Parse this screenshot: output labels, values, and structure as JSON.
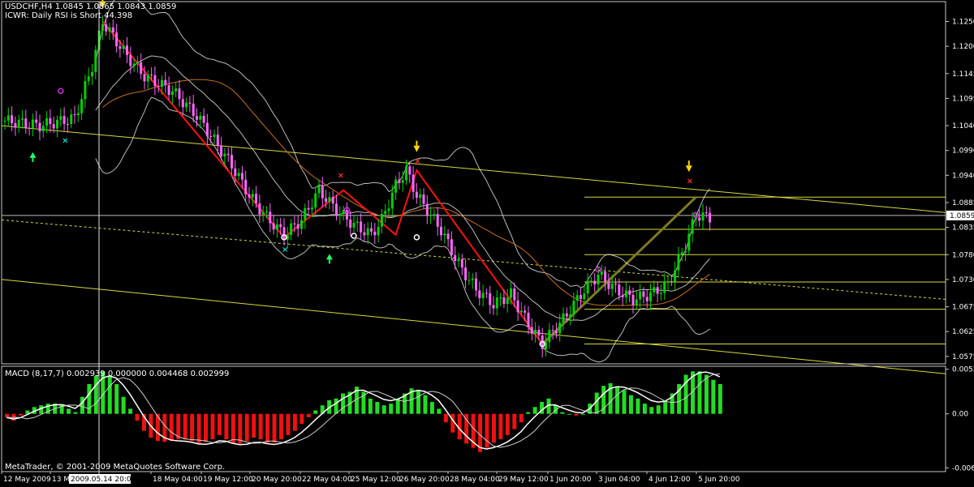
{
  "header": {
    "symbol_line": "USDCHF,H4 1.0845 1.0865 1.0843 1.0859",
    "indicator_line": "ICWR: Daily RSI is Short 44.398"
  },
  "macd": {
    "label": "MACD (8,17,7) 0.002939 0.000000 0.004468 0.002999"
  },
  "footer": {
    "copyright": "MetaTrader, © 2001-2009 MetaQuotes Software Corp."
  },
  "chart_data": [
    {
      "type": "candlestick",
      "symbol": "USDCHF",
      "timeframe": "H4",
      "ohlc_last": {
        "open": 1.0845,
        "high": 1.0865,
        "low": 1.0843,
        "close": 1.0859
      },
      "y_ticks": [
        "1.1250",
        "1.1200",
        "1.1145",
        "1.1095",
        "1.1040",
        "1.0990",
        "1.0940",
        "1.0885",
        "1.0835",
        "1.0780",
        "1.0730",
        "1.0675",
        "1.0625",
        "1.0575"
      ],
      "ylim": [
        1.056,
        1.129
      ],
      "current_price_label": "1.0859",
      "x_labels": [
        "12 May 2009",
        "13 M",
        "2009.05.14 20:00",
        "18 May 04:00",
        "19 May 12:00",
        "20 May 20:00",
        "22 May 04:00",
        "25 May 12:00",
        "26 May 20:00",
        "28 May 04:00",
        "29 May 12:00",
        "1 Jun 20:00",
        "3 Jun 04:00",
        "4 Jun 12:00",
        "5 Jun 20:00"
      ],
      "highlighted_x_label": "2009.05.14 20:00",
      "close_path": [
        [
          0,
          1.105
        ],
        [
          10,
          1.104
        ],
        [
          20,
          1.1055
        ],
        [
          25,
          1.116
        ],
        [
          28,
          1.125
        ],
        [
          35,
          1.118
        ],
        [
          40,
          1.114
        ],
        [
          48,
          1.111
        ],
        [
          55,
          1.106
        ],
        [
          60,
          1.101
        ],
        [
          65,
          1.096
        ],
        [
          70,
          1.09
        ],
        [
          75,
          1.0855
        ],
        [
          80,
          1.082
        ],
        [
          85,
          1.085
        ],
        [
          90,
          1.091
        ],
        [
          95,
          1.087
        ],
        [
          100,
          1.084
        ],
        [
          105,
          1.082
        ],
        [
          108,
          1.085
        ],
        [
          112,
          1.092
        ],
        [
          115,
          1.095
        ],
        [
          118,
          1.09
        ],
        [
          125,
          1.083
        ],
        [
          130,
          1.076
        ],
        [
          135,
          1.071
        ],
        [
          140,
          1.068
        ],
        [
          145,
          1.07
        ],
        [
          150,
          1.064
        ],
        [
          154,
          1.06
        ],
        [
          160,
          1.065
        ],
        [
          165,
          1.07
        ],
        [
          170,
          1.074
        ],
        [
          175,
          1.071
        ],
        [
          180,
          1.069
        ],
        [
          185,
          1.07
        ],
        [
          190,
          1.072
        ],
        [
          195,
          1.08
        ],
        [
          198,
          1.086
        ],
        [
          202,
          1.0855
        ]
      ],
      "zigzag": [
        [
          28,
          1.125
        ],
        [
          80,
          1.0815
        ],
        [
          97,
          1.091
        ],
        [
          112,
          1.082
        ],
        [
          118,
          1.095
        ],
        [
          154,
          1.06
        ]
      ],
      "horizontal_levels": [
        1.0896,
        1.0831,
        1.078,
        1.0725,
        1.067,
        1.06
      ],
      "current_price": 1.0859,
      "markers": [
        {
          "label": "×",
          "x": 96,
          "price": 1.094,
          "color": "#ff3030"
        },
        {
          "label": "×",
          "x": 118,
          "price": 1.0968,
          "color": "#ff3030"
        },
        {
          "label": "×",
          "x": 196,
          "price": 1.0928,
          "color": "#ff3030"
        },
        {
          "label": "×",
          "x": 80,
          "price": 1.079,
          "color": "#00e0e0"
        },
        {
          "label": "×",
          "x": 17,
          "price": 1.101,
          "color": "#00e0e0"
        }
      ]
    },
    {
      "type": "bar",
      "name": "MACD",
      "y_ticks": [
        "0.00525",
        "0.00",
        "-0.00636"
      ],
      "ylim": [
        -0.0068,
        0.0056
      ],
      "histogram": [
        -0.0004,
        -0.0008,
        -0.0002,
        0.0004,
        0.0008,
        0.001,
        0.0012,
        0.0012,
        0.001,
        0.0006,
        0.0002,
        0.002,
        0.0035,
        0.0045,
        0.005,
        0.0044,
        0.0035,
        0.002,
        0.0006,
        -0.0008,
        -0.002,
        -0.0028,
        -0.0032,
        -0.0033,
        -0.0032,
        -0.003,
        -0.003,
        -0.0032,
        -0.0035,
        -0.0033,
        -0.003,
        -0.0025,
        -0.003,
        -0.0035,
        -0.0035,
        -0.0032,
        -0.0028,
        -0.003,
        -0.0034,
        -0.0034,
        -0.003,
        -0.0025,
        -0.002,
        -0.0012,
        -0.0004,
        0.0004,
        0.001,
        0.0016,
        0.0018,
        0.0024,
        0.0026,
        0.0032,
        0.0026,
        0.0018,
        0.0014,
        0.001,
        0.0012,
        0.0018,
        0.0024,
        0.003,
        0.0028,
        0.0022,
        0.0014,
        0.0006,
        -0.001,
        -0.0022,
        -0.003,
        -0.0035,
        -0.004,
        -0.0045,
        -0.004,
        -0.0034,
        -0.003,
        -0.0025,
        -0.0018,
        -0.001,
        0.0002,
        0.0008,
        0.0014,
        0.0018,
        0.001,
        0.0002,
        0.0,
        -0.0002,
        0.0,
        0.0012,
        0.0025,
        0.0033,
        0.0036,
        0.0032,
        0.0028,
        0.0022,
        0.0018,
        0.0012,
        0.0008,
        0.001,
        0.0015,
        0.0024,
        0.0035,
        0.0046,
        0.005,
        0.005,
        0.0046,
        0.004,
        0.0035
      ],
      "macd_line_last": 0.002939,
      "signal_line_last": 0.002999
    }
  ],
  "colors": {
    "bull": "#00d000",
    "bear": "#ff66ff",
    "zigzag": "#ff1010",
    "levels": "#d8d840",
    "band": "#e8e8e8",
    "ma": "#c87020",
    "hist_up": "#22dd22",
    "hist_down": "#ee1111"
  }
}
